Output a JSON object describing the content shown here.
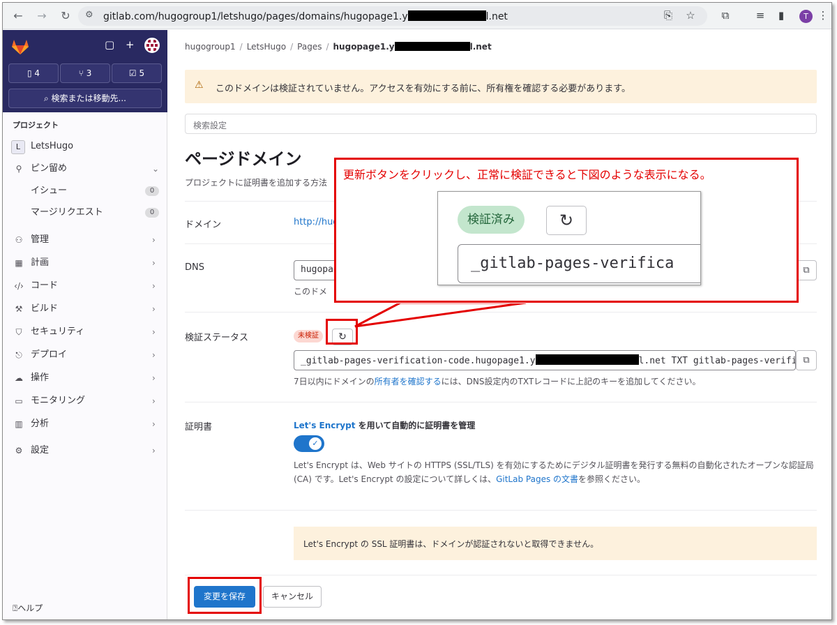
{
  "browser": {
    "url_prefix": "gitlab.com/hugogroup1/letshugo/pages/domains/hugopage1.y",
    "url_suffix": "l.net",
    "avatar_letter": "T"
  },
  "sidebar": {
    "counts": {
      "issues": "4",
      "merge_requests": "3",
      "todos": "5"
    },
    "search_label": "検索または移動先...",
    "section_label": "プロジェクト",
    "project": {
      "initial": "L",
      "name": "LetsHugo"
    },
    "pinned": "ピン留め",
    "pinned_items": [
      {
        "label": "イシュー",
        "count": "0"
      },
      {
        "label": "マージリクエスト",
        "count": "0"
      }
    ],
    "items": [
      "管理",
      "計画",
      "コード",
      "ビルド",
      "セキュリティ",
      "デプロイ",
      "操作",
      "モニタリング",
      "分析",
      "設定"
    ],
    "help_label": "ヘルプ"
  },
  "main": {
    "breadcrumbs": [
      "hugogroup1",
      "LetsHugo",
      "Pages"
    ],
    "crumb_current_prefix": "hugopage1.y",
    "crumb_current_suffix": "l.net",
    "alert_text": "このドメインは検証されていません。アクセスを有効にする前に、所有権を確認する必要があります。",
    "search_settings_placeholder": "検索設定",
    "title": "ページドメイン",
    "subtitle": "プロジェクトに証明書を追加する方法",
    "domain_label": "ドメイン",
    "domain_link": "http://hug",
    "dns_label": "DNS",
    "dns_value": "hugopag",
    "dns_help": "このドメ",
    "status_label": "検証ステータス",
    "status_badge": "未検証",
    "verification_prefix": "_gitlab-pages-verification-code.hugopage1.y",
    "verification_suffix": "l.net TXT gitlab-pages-verific",
    "verification_help_1": "7日以内にドメインの",
    "verification_help_link": "所有者を確認する",
    "verification_help_2": "には、DNS設定内のTXTレコードに上記のキーを追加してください。",
    "cert_label": "証明書",
    "le_link": "Let's Encrypt",
    "le_title_rest": " を用いて自動的に証明書を管理",
    "le_desc_1": "Let's Encrypt は、Web サイトの HTTPS (SSL/TLS) を有効にするためにデジタル証明書を発行する無料の自動化されたオープンな認証局 (CA) です。Let's Encrypt の設定について詳しくは、",
    "le_desc_link": "GitLab Pages の文書",
    "le_desc_2": "を参照ください。",
    "toggle_on": true,
    "ssl_note": "Let's Encrypt の SSL 証明書は、ドメインが認証されないと取得できません。",
    "save_label": "変更を保存",
    "cancel_label": "キャンセル"
  },
  "annotation": {
    "callout_text": "更新ボタンをクリックし、正常に検証できると下図のような表示になる。",
    "zoom_badge": "検証済み",
    "zoom_field": "_gitlab-pages-verifica"
  },
  "colors": {
    "accent": "#1f75cb",
    "sidebar_top": "#292961",
    "annotation_red": "#e40000",
    "verified_green": "#c3e6cd"
  }
}
